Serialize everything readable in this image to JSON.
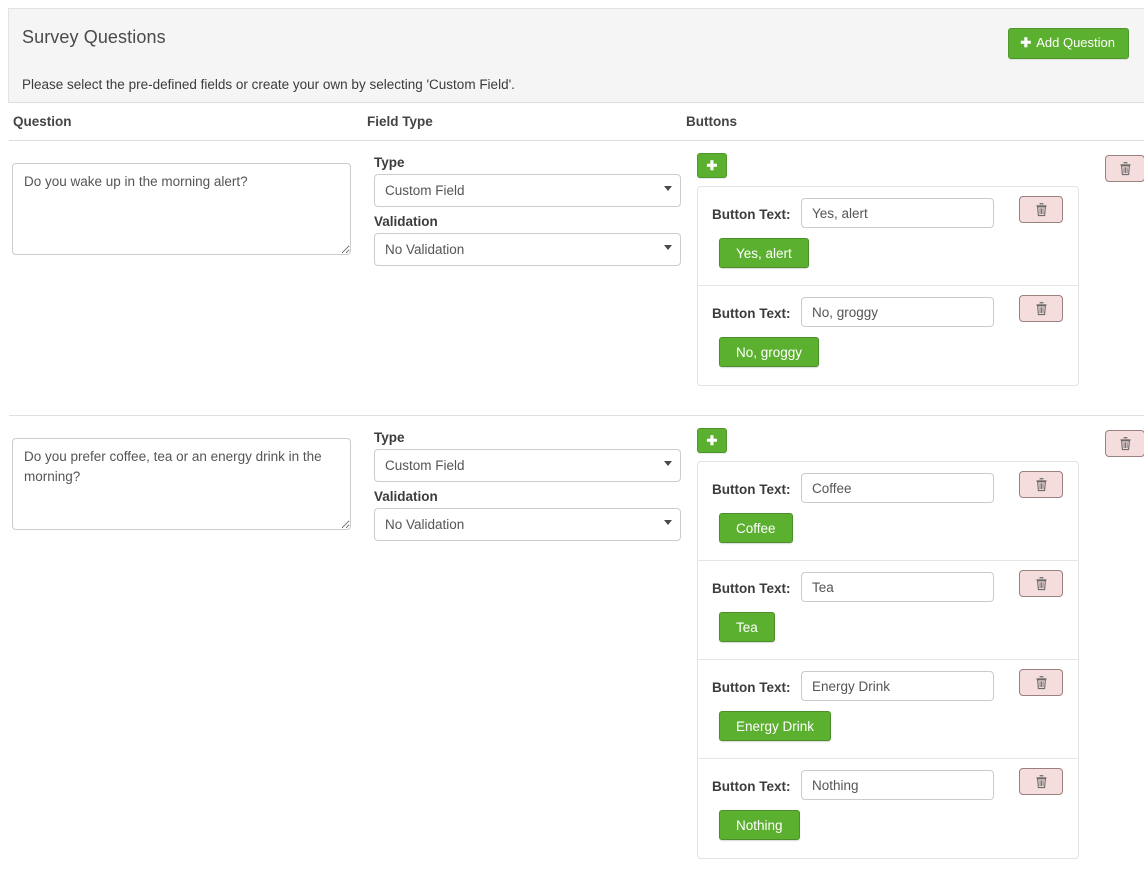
{
  "panel": {
    "title": "Survey Questions",
    "subtitle": "Please select the pre-defined fields or create your own by selecting 'Custom Field'.",
    "add_question_label": "Add Question",
    "add_question_icon": "plus-icon",
    "accent_green": "#5cb030",
    "delete_pink": "#f5dddd"
  },
  "table": {
    "headers": [
      "Question",
      "Field Type",
      "Buttons"
    ]
  },
  "labels": {
    "type": "Type",
    "validation": "Validation",
    "button_text": "Button Text:",
    "add_button_icon": "plus-icon",
    "delete_icon": "trash-icon",
    "add_button_label": "+"
  },
  "options": {
    "type": [
      "Custom Field"
    ],
    "validation": [
      "No Validation"
    ]
  },
  "rows": [
    {
      "question": "Do you wake up in the morning alert?",
      "type_value": "Custom Field",
      "validation_value": "No Validation",
      "buttons": [
        {
          "text": "Yes, alert",
          "preview": "Yes, alert"
        },
        {
          "text": "No, groggy",
          "preview": "No, groggy"
        }
      ]
    },
    {
      "question": "Do you prefer coffee, tea or an energy drink in the morning?",
      "type_value": "Custom Field",
      "validation_value": "No Validation",
      "buttons": [
        {
          "text": "Coffee",
          "preview": "Coffee"
        },
        {
          "text": "Tea",
          "preview": "Tea"
        },
        {
          "text": "Energy Drink",
          "preview": "Energy Drink"
        },
        {
          "text": "Nothing",
          "preview": "Nothing"
        }
      ]
    }
  ]
}
